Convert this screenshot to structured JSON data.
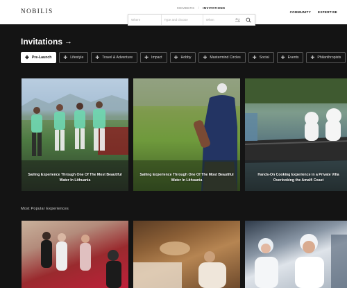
{
  "header": {
    "logo": "NOBILIS",
    "nav": {
      "item1": "MEMBERS",
      "sep": "/",
      "item2": "INVITATIONS"
    },
    "right_nav": [
      "COMMUNITY",
      "EXPERTISE"
    ],
    "search": {
      "field1": "Where",
      "field2": "Type and choose",
      "field3": "When",
      "toggle_icon": "sliders-icon",
      "search_icon": "search-icon"
    }
  },
  "page": {
    "title": "Invitations",
    "title_arrow": "→"
  },
  "chips": [
    {
      "label": "Pre-Launch",
      "active": true
    },
    {
      "label": "Lifestyle",
      "active": false
    },
    {
      "label": "Travel & Adventure",
      "active": false
    },
    {
      "label": "Impact",
      "active": false
    },
    {
      "label": "Hobby",
      "active": false
    },
    {
      "label": "Mastermind Circles",
      "active": false
    },
    {
      "label": "Social",
      "active": false
    },
    {
      "label": "Events",
      "active": false
    },
    {
      "label": "Philanthropists",
      "active": false
    }
  ],
  "cards": [
    {
      "caption": "Sailing Experience Through One Of The Most Beautiful Water In Lithuania"
    },
    {
      "caption": "Sailing Experience Through One Of The Most Beautiful Water In Lithuania"
    },
    {
      "caption": "Hands-On Cooking Experience in a Private Villa Overlooking the Amalfi Coast"
    }
  ],
  "popular": {
    "title": "Most Popular Experiences"
  },
  "colors": {
    "background": "#141414",
    "header": "#ffffff",
    "accent_mint": "#6fd6b0"
  }
}
